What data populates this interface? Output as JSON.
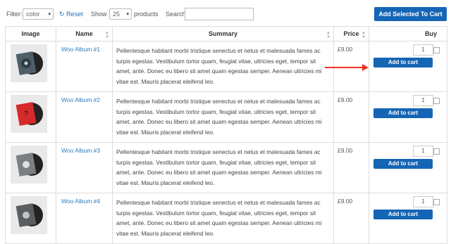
{
  "toolbar": {
    "filter_label": "Filter:",
    "filter_value": "color",
    "reset_label": "Reset",
    "show_label": "Show",
    "show_value": "25",
    "products_label": "products",
    "search_label": "Search:",
    "search_value": "",
    "add_selected_label": "Add Selected To Cart"
  },
  "table": {
    "headers": [
      "Image",
      "Name",
      "Summary",
      "Price",
      "Buy"
    ],
    "rows": [
      {
        "name": "Woo Album #1",
        "summary": "Pellentesque habitant morbi tristique senectus et netus et malesuada fames ac turpis egestas. Vestibulum tortor quam, feugiat vitae, ultricies eget, tempor sit amet, ante. Donec eu libero sit amet quam egestas semper. Aenean ultricies mi vitae est. Mauris placerat eleifend leo.",
        "price": "£9.00",
        "qty": "1",
        "add_label": "Add to cart"
      },
      {
        "name": "Woo Album #2",
        "summary": "Pellentesque habitant morbi tristique senectus et netus et malesuada fames ac turpis egestas. Vestibulum tortor quam, feugiat vitae, ultricies eget, tempor sit amet, ante. Donec eu libero sit amet quam egestas semper. Aenean ultricies mi vitae est. Mauris placerat eleifend leo.",
        "price": "£9.00",
        "qty": "1",
        "add_label": "Add to cart"
      },
      {
        "name": "Woo Album #3",
        "summary": "Pellentesque habitant morbi tristique senectus et netus et malesuada fames ac turpis egestas. Vestibulum tortor quam, feugiat vitae, ultricies eget, tempor sit amet, ante. Donec eu libero sit amet quam egestas semper. Aenean ultricies mi vitae est. Mauris placerat eleifend leo.",
        "price": "£9.00",
        "qty": "1",
        "add_label": "Add to cart"
      },
      {
        "name": "Woo Album #4",
        "summary": "Pellentesque habitant morbi tristique senectus et netus et malesuada fames ac turpis egestas. Vestibulum tortor quam, feugiat vitae, ultricies eget, tempor sit amet, ante. Donec eu libero sit amet quam egestas semper. Aenean ultricies mi vitae est. Mauris placerat eleifend leo.",
        "price": "£9.00",
        "qty": "1",
        "add_label": "Add to cart"
      }
    ]
  },
  "colors": {
    "accent": "#1565b5",
    "link": "#2a7bbd",
    "annotation_arrow": "#e32222"
  },
  "icons": {
    "reset": "refresh-icon",
    "sort": "sort-icon",
    "dropdown": "chevron-down-icon"
  }
}
